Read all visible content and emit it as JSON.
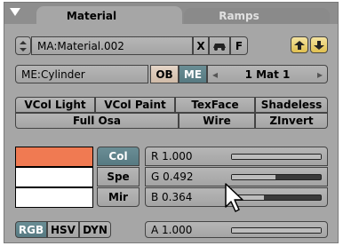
{
  "tabs": {
    "active": "Material",
    "inactive": "Ramps"
  },
  "material_row": {
    "name": "MA:Material.002",
    "x_label": "X",
    "fake_label": "F"
  },
  "object_row": {
    "mesh_name": "ME:Cylinder",
    "ob_label": "OB",
    "me_label": "ME",
    "mat_label": "1 Mat 1"
  },
  "toggles": {
    "row1": [
      "VCol Light",
      "VCol Paint",
      "TexFace",
      "Shadeless"
    ],
    "row2": [
      "Full Osa",
      "Wire",
      "ZInvert"
    ]
  },
  "swatches": {
    "col": "#f07a52",
    "spe": "#ffffff",
    "mir": "#ffffff"
  },
  "swatch_buttons": [
    "Col",
    "Spe",
    "Mir"
  ],
  "color": {
    "r": {
      "label": "R 1.000",
      "value": 1.0
    },
    "g": {
      "label": "G 0.492",
      "value": 0.492
    },
    "b": {
      "label": "B 0.364",
      "value": 0.364
    },
    "a": {
      "label": "A 1.000",
      "value": 1.0
    }
  },
  "mode_buttons": [
    "RGB",
    "HSV",
    "DYN"
  ]
}
